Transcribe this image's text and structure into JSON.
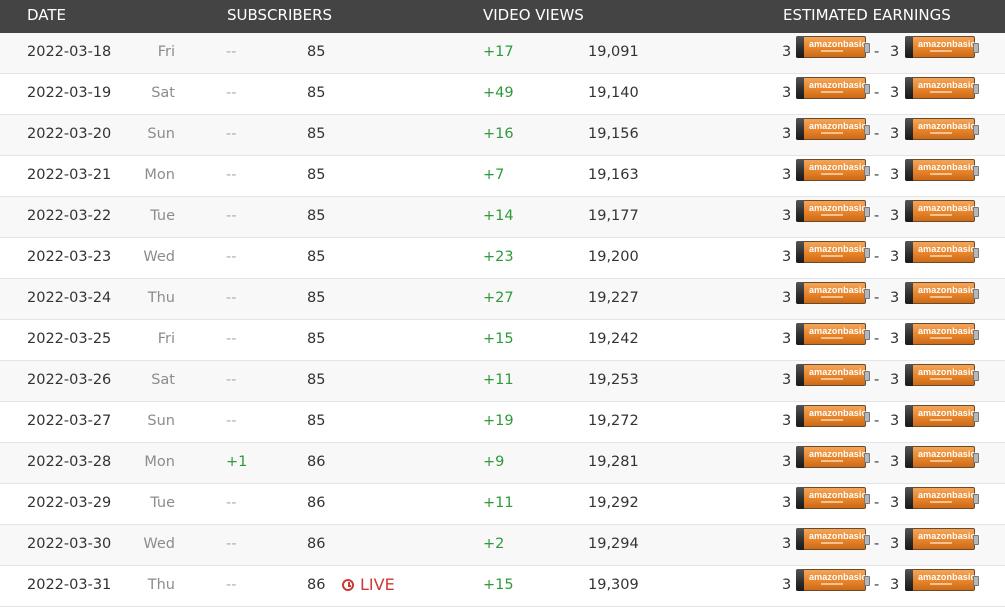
{
  "header": {
    "date": "DATE",
    "subscribers": "SUBSCRIBERS",
    "video_views": "VIDEO VIEWS",
    "estimated_earnings": "ESTIMATED EARNINGS"
  },
  "battery_brand": "amazonbasics",
  "rows": [
    {
      "date": "2022-03-18",
      "dow": "Fri",
      "sub_change": "--",
      "subscribers": "85",
      "live": "",
      "view_change": "+17",
      "views": "19,091",
      "earn_low": "3",
      "dash": "-",
      "earn_high": "3"
    },
    {
      "date": "2022-03-19",
      "dow": "Sat",
      "sub_change": "--",
      "subscribers": "85",
      "live": "",
      "view_change": "+49",
      "views": "19,140",
      "earn_low": "3",
      "dash": "-",
      "earn_high": "3"
    },
    {
      "date": "2022-03-20",
      "dow": "Sun",
      "sub_change": "--",
      "subscribers": "85",
      "live": "",
      "view_change": "+16",
      "views": "19,156",
      "earn_low": "3",
      "dash": "-",
      "earn_high": "3"
    },
    {
      "date": "2022-03-21",
      "dow": "Mon",
      "sub_change": "--",
      "subscribers": "85",
      "live": "",
      "view_change": "+7",
      "views": "19,163",
      "earn_low": "3",
      "dash": "-",
      "earn_high": "3"
    },
    {
      "date": "2022-03-22",
      "dow": "Tue",
      "sub_change": "--",
      "subscribers": "85",
      "live": "",
      "view_change": "+14",
      "views": "19,177",
      "earn_low": "3",
      "dash": "-",
      "earn_high": "3"
    },
    {
      "date": "2022-03-23",
      "dow": "Wed",
      "sub_change": "--",
      "subscribers": "85",
      "live": "",
      "view_change": "+23",
      "views": "19,200",
      "earn_low": "3",
      "dash": "-",
      "earn_high": "3"
    },
    {
      "date": "2022-03-24",
      "dow": "Thu",
      "sub_change": "--",
      "subscribers": "85",
      "live": "",
      "view_change": "+27",
      "views": "19,227",
      "earn_low": "3",
      "dash": "-",
      "earn_high": "3"
    },
    {
      "date": "2022-03-25",
      "dow": "Fri",
      "sub_change": "--",
      "subscribers": "85",
      "live": "",
      "view_change": "+15",
      "views": "19,242",
      "earn_low": "3",
      "dash": "-",
      "earn_high": "3"
    },
    {
      "date": "2022-03-26",
      "dow": "Sat",
      "sub_change": "--",
      "subscribers": "85",
      "live": "",
      "view_change": "+11",
      "views": "19,253",
      "earn_low": "3",
      "dash": "-",
      "earn_high": "3"
    },
    {
      "date": "2022-03-27",
      "dow": "Sun",
      "sub_change": "--",
      "subscribers": "85",
      "live": "",
      "view_change": "+19",
      "views": "19,272",
      "earn_low": "3",
      "dash": "-",
      "earn_high": "3"
    },
    {
      "date": "2022-03-28",
      "dow": "Mon",
      "sub_change": "+1",
      "subscribers": "86",
      "live": "",
      "view_change": "+9",
      "views": "19,281",
      "earn_low": "3",
      "dash": "-",
      "earn_high": "3"
    },
    {
      "date": "2022-03-29",
      "dow": "Tue",
      "sub_change": "--",
      "subscribers": "86",
      "live": "",
      "view_change": "+11",
      "views": "19,292",
      "earn_low": "3",
      "dash": "-",
      "earn_high": "3"
    },
    {
      "date": "2022-03-30",
      "dow": "Wed",
      "sub_change": "--",
      "subscribers": "86",
      "live": "",
      "view_change": "+2",
      "views": "19,294",
      "earn_low": "3",
      "dash": "-",
      "earn_high": "3"
    },
    {
      "date": "2022-03-31",
      "dow": "Thu",
      "sub_change": "--",
      "subscribers": "86",
      "live": "LIVE",
      "view_change": "+15",
      "views": "19,309",
      "earn_low": "3",
      "dash": "-",
      "earn_high": "3"
    }
  ]
}
